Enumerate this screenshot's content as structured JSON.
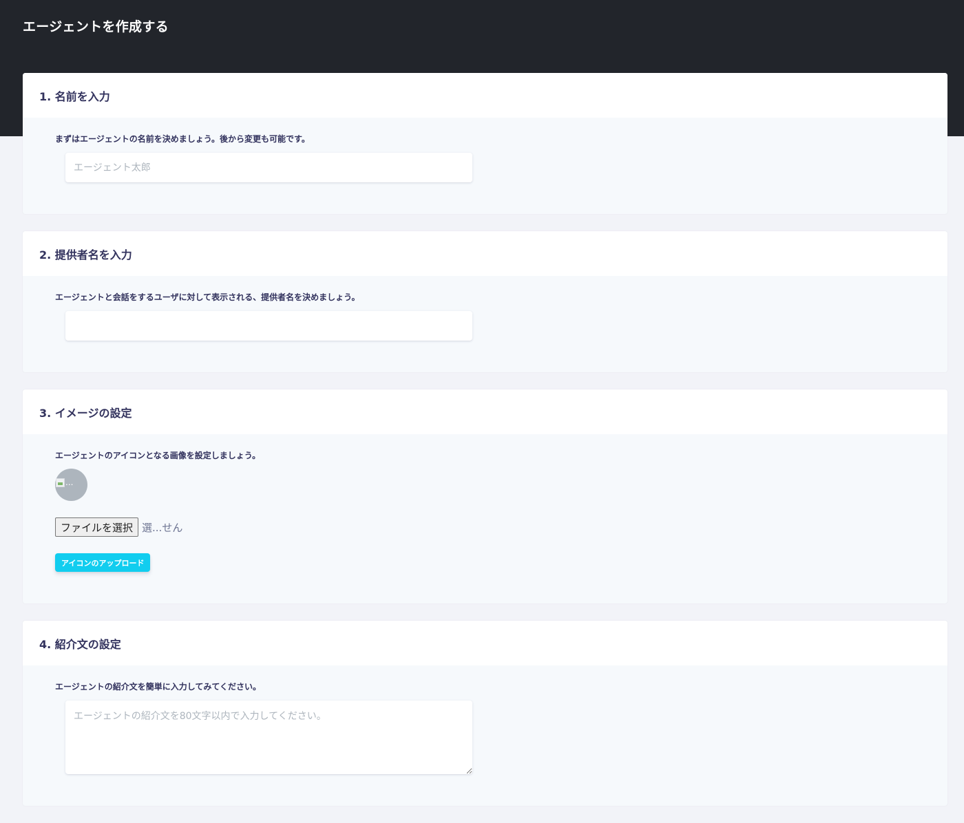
{
  "page": {
    "title": "エージェントを作成する"
  },
  "sections": {
    "name": {
      "header": "1. 名前を入力",
      "description": "まずはエージェントの名前を決めましょう。後から変更も可能です。",
      "input_value": "",
      "input_placeholder": "エージェント太郎"
    },
    "provider": {
      "header": "2. 提供者名を入力",
      "description": "エージェントと会話をするユーザに対して表示される、提供者名を決めましょう。",
      "input_value": "",
      "input_placeholder": ""
    },
    "image": {
      "header": "3. イメージの設定",
      "description": "エージェントのアイコンとなる画像を設定しましょう。",
      "avatar_alt": "...",
      "file_button_label": "ファイルを選択",
      "file_status": "選...せん",
      "upload_button_label": "アイコンのアップロード"
    },
    "intro": {
      "header": "4. 紹介文の設定",
      "description": "エージェントの紹介文を簡単に入力してみてください。",
      "textarea_value": "",
      "textarea_placeholder": "エージェントの紹介文を80文字以内で入力してください。"
    }
  },
  "colors": {
    "header_bg": "#22252b",
    "page_bg": "#f2f3f8",
    "accent": "#11cdef",
    "text": "#32325d"
  },
  "icons": {
    "avatar_placeholder": "broken-image-icon"
  }
}
